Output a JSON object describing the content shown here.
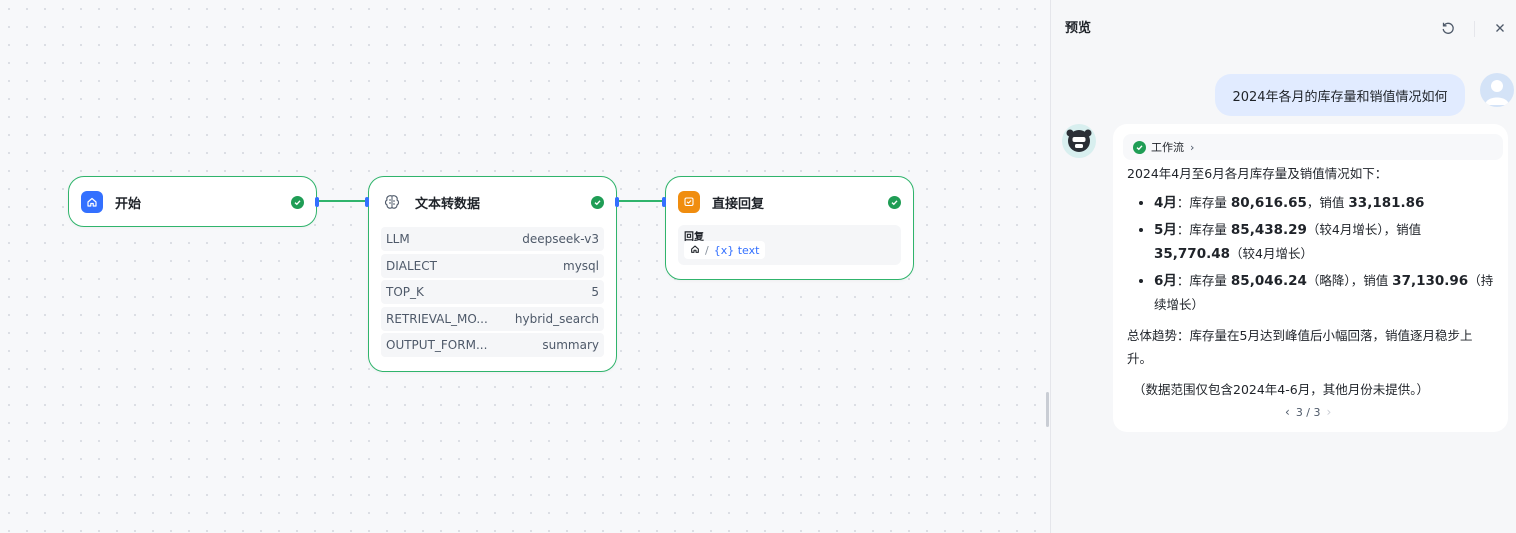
{
  "workflow": {
    "start_node": {
      "title": "开始",
      "status": "success"
    },
    "text2data_node": {
      "title": "文本转数据",
      "status": "success",
      "params": [
        {
          "key": "LLM",
          "value": "deepseek-v3"
        },
        {
          "key": "DIALECT",
          "value": "mysql"
        },
        {
          "key": "TOP_K",
          "value": "5"
        },
        {
          "key": "RETRIEVAL_MO...",
          "value": "hybrid_search"
        },
        {
          "key": "OUTPUT_FORM...",
          "value": "summary"
        }
      ]
    },
    "reply_node": {
      "title": "直接回复",
      "status": "success",
      "reply_label": "回复",
      "variable": "{x} text",
      "separator": "/"
    },
    "colors": {
      "accent": "#3370ff",
      "success": "#30b46c",
      "reply_icon": "#f08d0f"
    }
  },
  "preview": {
    "title": "预览",
    "user_message": "2024年各月的库存量和销值情况如何",
    "workflow_chip": "工作流",
    "answer": {
      "intro": "2024年4月至6月各月库存量及销值情况如下：",
      "items": [
        {
          "month": "4月",
          "colon": "：",
          "stock_label": "库存量 ",
          "stock": "80,616.65",
          "stock_note": "",
          "sales_label": "，销值 ",
          "sales": "33,181.86",
          "sales_note": ""
        },
        {
          "month": "5月",
          "colon": "：",
          "stock_label": "库存量 ",
          "stock": "85,438.29",
          "stock_note": "（较4月增长）",
          "sales_label": "，销值 ",
          "sales": "35,770.48",
          "sales_note": "（较4月增长）"
        },
        {
          "month": "6月",
          "colon": "：",
          "stock_label": "库存量 ",
          "stock": "85,046.24",
          "stock_note": "（略降）",
          "sales_label": "，销值 ",
          "sales": "37,130.96",
          "sales_note": "（持续增长）"
        }
      ],
      "summary": "总体趋势：库存量在5月达到峰值后小幅回落，销值逐月稳步上升。",
      "note": "（数据范围仅包含2024年4-6月，其他月份未提供。）"
    },
    "pager": "3 / 3"
  }
}
